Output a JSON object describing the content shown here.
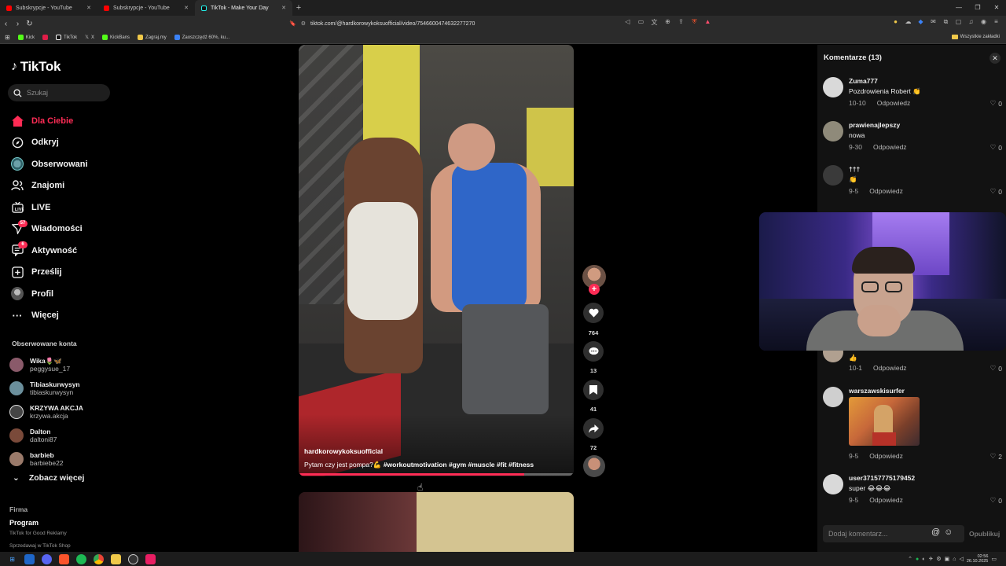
{
  "browser": {
    "tabs": [
      {
        "title": "Subskrypcje - YouTube",
        "color": "#ff0000"
      },
      {
        "title": "Subskrypcje - YouTube",
        "color": "#ff0000"
      },
      {
        "title": "TikTok - Make Your Day",
        "color": "#25f4ee"
      }
    ],
    "new_tab": "+",
    "url": "tiktok.com/@hardkorowykoksuofficial/video/7546600474632277270",
    "bookmarks": [
      "Kick",
      "TikTok",
      "X",
      "KickBans",
      "Zagraj.my",
      "Zaoszczędź 60%, ku..."
    ],
    "bookmarks_all": "Wszystkie zakładki"
  },
  "sidebar": {
    "logo": "TikTok",
    "search_placeholder": "Szukaj",
    "nav": [
      {
        "label": "Dla Ciebie",
        "icon": "home-icon"
      },
      {
        "label": "Odkryj",
        "icon": "compass-icon"
      },
      {
        "label": "Obserwowani",
        "icon": "following-avatar-icon"
      },
      {
        "label": "Znajomi",
        "icon": "friends-icon"
      },
      {
        "label": "LIVE",
        "icon": "live-icon"
      },
      {
        "label": "Wiadomości",
        "icon": "messages-icon",
        "badge": "57"
      },
      {
        "label": "Aktywność",
        "icon": "activity-icon",
        "badge": "6"
      },
      {
        "label": "Prześlij",
        "icon": "upload-icon"
      },
      {
        "label": "Profil",
        "icon": "profile-icon"
      },
      {
        "label": "Więcej",
        "icon": "more-icon"
      }
    ],
    "followed_title": "Obserwowane konta",
    "followed": [
      {
        "name": "Wika🌷🦋",
        "handle": "peggysue_17",
        "color": "#8a5a6a"
      },
      {
        "name": "Tibiaskurwysyn",
        "handle": "tibiaskurwysyn",
        "color": "#6b8f9c"
      },
      {
        "name": "KRZYWA AKCJA",
        "handle": "krzywa.akcja",
        "color": "#444444"
      },
      {
        "name": "Dalton",
        "handle": "daltoni87",
        "color": "#7a4a3a"
      },
      {
        "name": "barbieb",
        "handle": "barbiebe22",
        "color": "#9a7a6a"
      }
    ],
    "see_more": "Zobacz więcej",
    "footer": {
      "heading": "Firma",
      "program": "Program",
      "line1": "TikTok for Good  Reklamy",
      "line2": "Sprzedawaj w TikTok Shop"
    }
  },
  "video": {
    "author": "hardkorowykoksuofficial",
    "caption": "Pytam czy jest pompa?💪",
    "tags": "#workoutmotivation #gym #muscle #fit #fitness",
    "progress": 0.82
  },
  "actions": {
    "likes": "764",
    "comments": "13",
    "saves": "41",
    "shares": "72"
  },
  "comments": {
    "title": "Komentarze (13)",
    "items": [
      {
        "user": "Zuma777",
        "text": "Pozdrowienia Robert 👏",
        "date": "10-10",
        "reply": "Odpowiedz",
        "likes": "0",
        "color": "#d9d9d9"
      },
      {
        "user": "prawienajlepszy",
        "text": "nowa",
        "date": "9-30",
        "reply": "Odpowiedz",
        "likes": "0",
        "color": "#8f8a7a"
      },
      {
        "user": "†††",
        "text": "👏",
        "date": "9-5",
        "reply": "Odpowiedz",
        "likes": "0",
        "color": "#3a3a3a"
      },
      {
        "user": "",
        "text": "👍",
        "date": "10-1",
        "reply": "Odpowiedz",
        "likes": "0",
        "color": "#b0a090"
      },
      {
        "user": "warszawskisurfer",
        "text": "",
        "date": "9-5",
        "reply": "Odpowiedz",
        "likes": "2",
        "color": "#cfcfcf"
      },
      {
        "user": "user37157775179452",
        "text": "super 😂😂😂",
        "date": "9-5",
        "reply": "Odpowiedz",
        "likes": "0",
        "color": "#d9d9d9"
      }
    ],
    "input_placeholder": "Dodaj komentarz...",
    "post": "Opublikuj"
  },
  "taskbar": {
    "time": "02:56",
    "date": "26.10.2025"
  }
}
